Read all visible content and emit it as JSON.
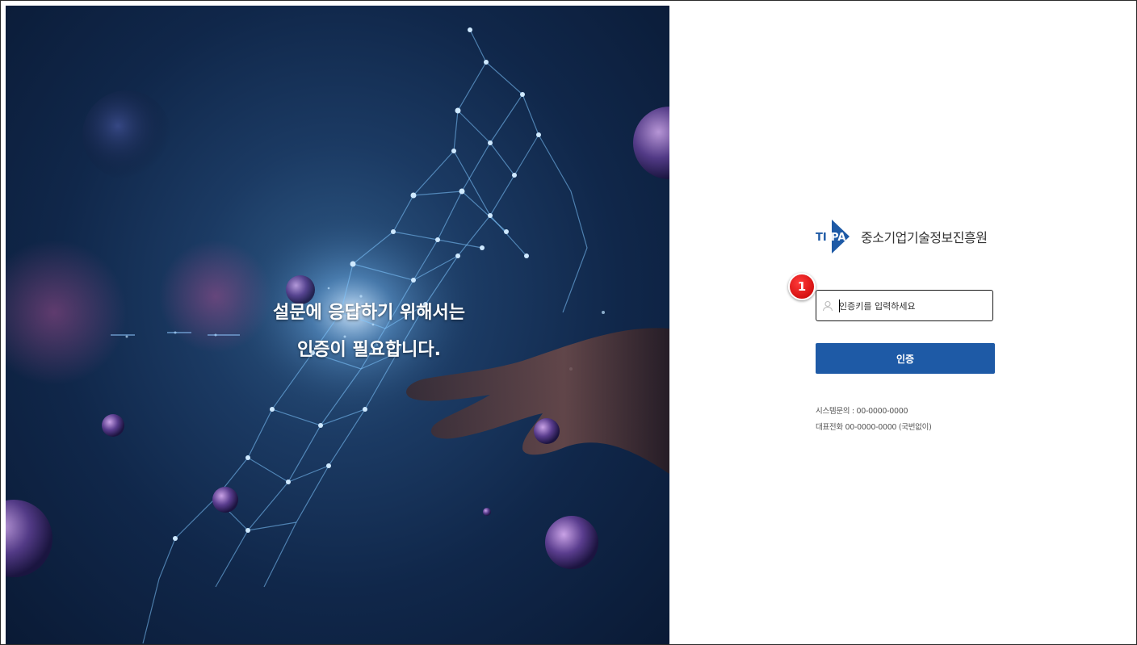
{
  "hero": {
    "line1": "설문에 응답하기 위해서는",
    "line2": "인증이 필요합니다."
  },
  "brand": {
    "logo_text_left": "TI",
    "logo_text_right": "PA",
    "name": "중소기업기술정보진흥원",
    "logo_color": "#1e5aa6"
  },
  "step_badge": {
    "number": "1",
    "color": "#d40000"
  },
  "auth_key": {
    "placeholder": "인증키를 입력하세요",
    "value": "",
    "icon": "user-icon"
  },
  "auth_button": {
    "label": "인증",
    "color": "#1e5aa6"
  },
  "contact": {
    "system_inquiry": "시스템문의 : 00-0000-0000",
    "main_phone": "대표전화 00-0000-0000 (국번없이)"
  }
}
